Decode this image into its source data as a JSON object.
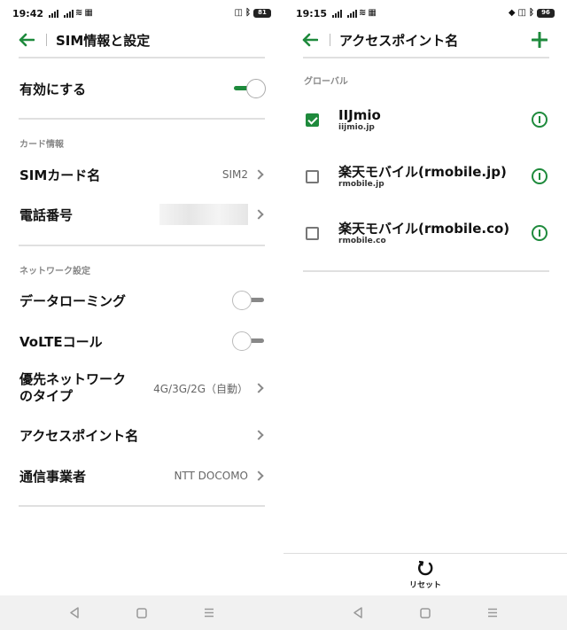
{
  "left_screen": {
    "status": {
      "time": "19:42",
      "battery": "81"
    },
    "title": "SIM情報と設定",
    "enable": {
      "label": "有効にする",
      "on": true
    },
    "card_section": "カード情報",
    "sim_name": {
      "label": "SIMカード名",
      "value": "SIM2"
    },
    "phone": {
      "label": "電話番号"
    },
    "network_section": "ネットワーク設定",
    "data_roaming": {
      "label": "データローミング",
      "on": false
    },
    "volte": {
      "label": "VoLTEコール",
      "on": false
    },
    "preferred_network": {
      "label_line1": "優先ネットワーク",
      "label_line2": "のタイプ",
      "value": "4G/3G/2G（自動）"
    },
    "apn": {
      "label": "アクセスポイント名"
    },
    "carrier": {
      "label": "通信事業者",
      "value": "NTT DOCOMO"
    }
  },
  "right_screen": {
    "status": {
      "time": "19:15",
      "battery": "96"
    },
    "title": "アクセスポイント名",
    "section": "グローバル",
    "apns": [
      {
        "name": "IIJmio",
        "sub": "iijmio.jp",
        "checked": true
      },
      {
        "name": "楽天モバイル(rmobile.jp)",
        "sub": "rmobile.jp",
        "checked": false
      },
      {
        "name": "楽天モバイル(rmobile.co)",
        "sub": "rmobile.co",
        "checked": false
      }
    ],
    "reset_label": "リセット"
  },
  "colors": {
    "accent": "#1e8a3c",
    "navbar_bg": "#f1f1f1"
  },
  "icons": [
    "back-arrow-icon",
    "chevron-right-icon",
    "plus-icon",
    "info-icon",
    "reset-icon",
    "nav-back-icon",
    "nav-home-icon",
    "nav-recents-icon"
  ]
}
